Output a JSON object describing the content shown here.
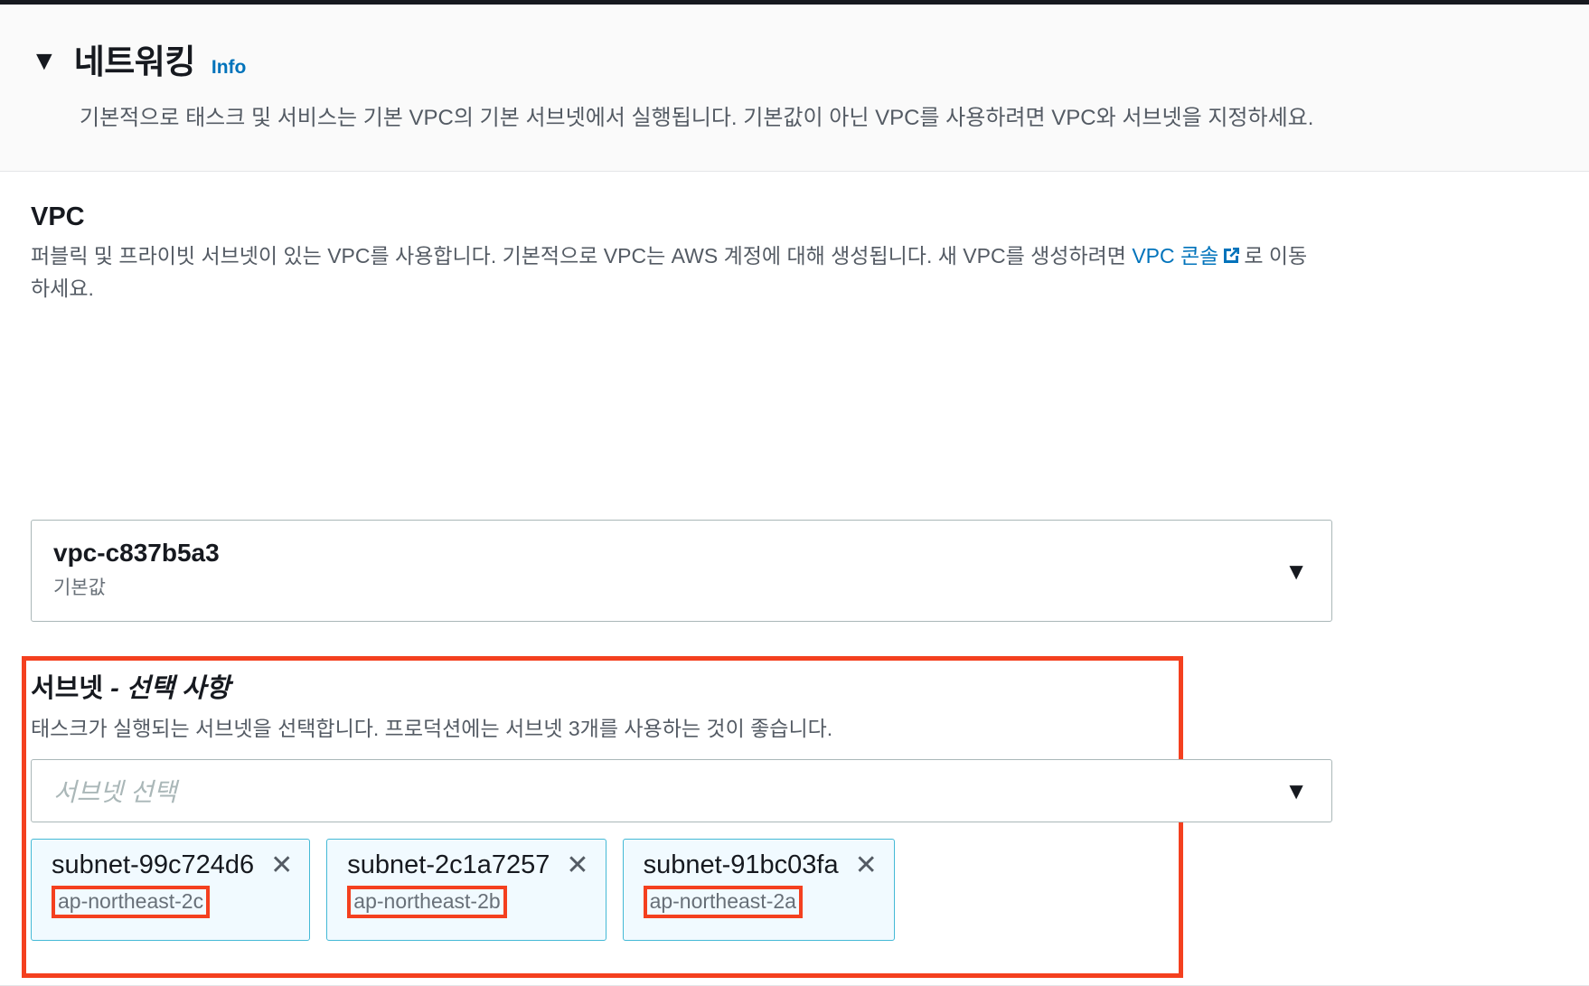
{
  "section": {
    "caret_glyph": "▼",
    "title": "네트워킹",
    "info_label": "Info",
    "description": "기본적으로 태스크 및 서비스는 기본 VPC의 기본 서브넷에서 실행됩니다. 기본값이 아닌 VPC를 사용하려면 VPC와 서브넷을 지정하세요."
  },
  "vpc": {
    "label": "VPC",
    "description_part1": "퍼블릭 및 프라이빗 서브넷이 있는 VPC를 사용합니다. 기본적으로 VPC는 AWS 계정에 대해 생성됩니다. 새 VPC를 생성하려면 ",
    "console_link": "VPC 콘솔",
    "description_part2": "로 이동하세요.",
    "selected_value": "vpc-c837b5a3",
    "selected_sub": "기본값",
    "caret_glyph": "▼"
  },
  "subnet": {
    "label_main": "서브넷 ",
    "label_optional": "- 선택 사항",
    "description": "태스크가 실행되는 서브넷을 선택합니다. 프로덕션에는 서브넷 3개를 사용하는 것이 좋습니다.",
    "placeholder": "서브넷 선택",
    "caret_glyph": "▼",
    "remove_glyph": "✕",
    "tokens": [
      {
        "id": "subnet-99c724d6",
        "az": "ap-northeast-2c"
      },
      {
        "id": "subnet-2c1a7257",
        "az": "ap-northeast-2b"
      },
      {
        "id": "subnet-91bc03fa",
        "az": "ap-northeast-2a"
      }
    ]
  },
  "colors": {
    "link_blue": "#0073bb",
    "annotation_red": "#f4401f",
    "token_bg": "#f1faff",
    "token_border": "#44b9d6",
    "header_bg": "#fafafa",
    "text_primary": "#16191f",
    "text_secondary": "#545b64"
  }
}
